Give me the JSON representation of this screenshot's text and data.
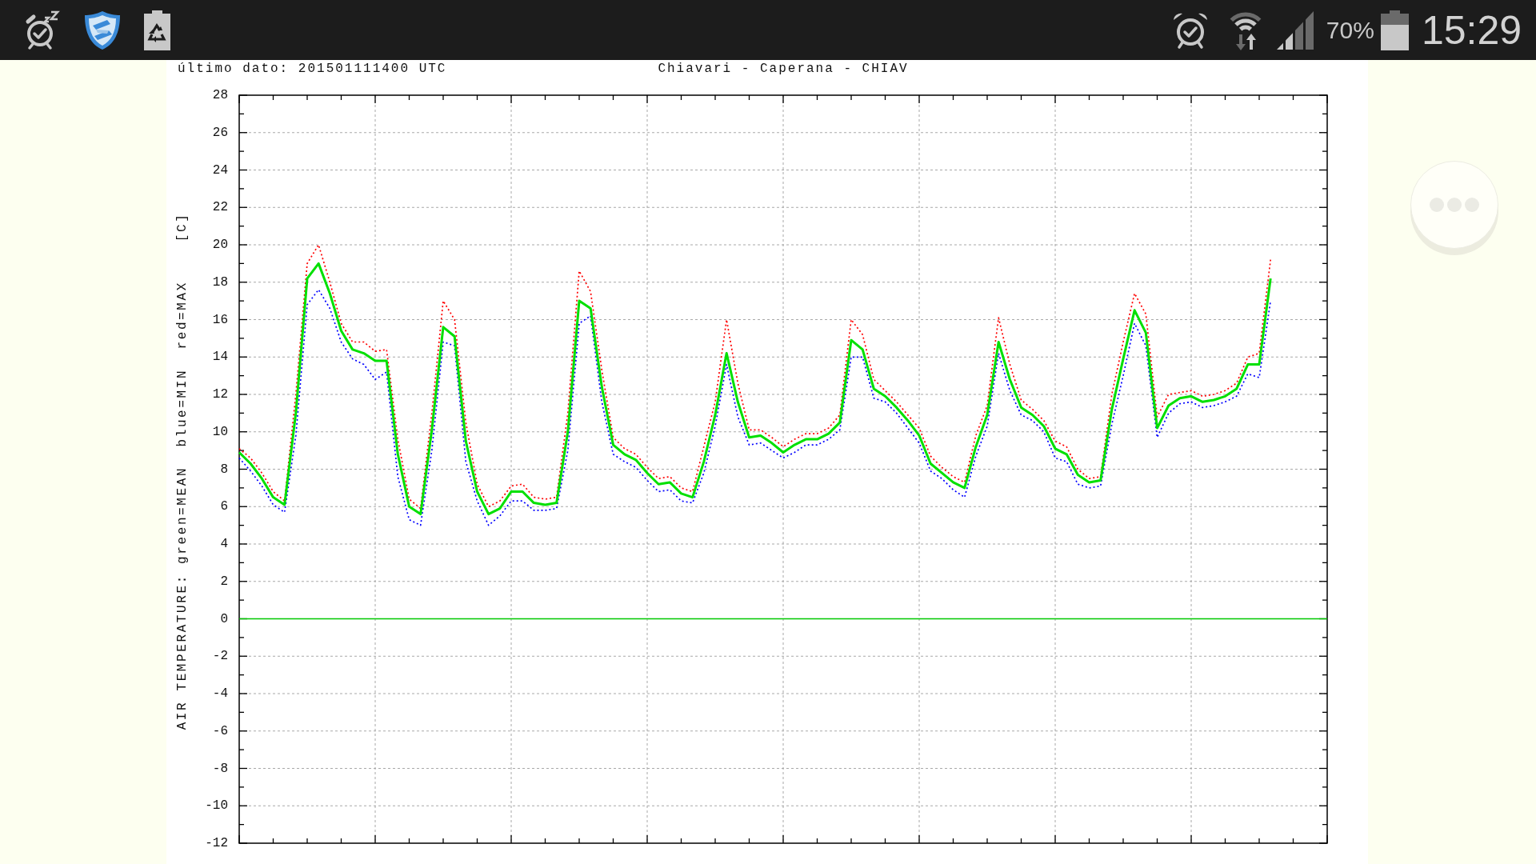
{
  "status_bar": {
    "battery": "70%",
    "time": "15:29"
  },
  "plot": {
    "last_data": "último dato: 201501111400 UTC",
    "chart_data": {
      "type": "line",
      "title": "Chiavari - Caperana - CHIAV",
      "ylabel": "AIR TEMPERATURE: green=MEAN  blue=MIN  red=MAX    [C]",
      "ylim": [
        -12,
        28
      ],
      "yticks": [
        -12,
        -10,
        -8,
        -6,
        -4,
        -2,
        0,
        2,
        4,
        6,
        8,
        10,
        12,
        14,
        16,
        18,
        20,
        22,
        24,
        26,
        28
      ],
      "grid": true,
      "series": [
        {
          "color": "#00e000",
          "line_style": "solid",
          "values": [
            8.9,
            8.3,
            7.5,
            6.5,
            6.1,
            11.0,
            18.2,
            19.0,
            17.4,
            15.4,
            14.4,
            14.2,
            13.8,
            13.8,
            8.8,
            6.0,
            5.6,
            10.1,
            15.6,
            15.1,
            9.5,
            6.8,
            5.6,
            5.9,
            6.8,
            6.8,
            6.2,
            6.1,
            6.2,
            10.0,
            17.0,
            16.6,
            12.4,
            9.3,
            8.8,
            8.5,
            7.8,
            7.2,
            7.3,
            6.7,
            6.5,
            8.4,
            10.9,
            14.2,
            11.6,
            9.7,
            9.8,
            9.4,
            8.9,
            9.3,
            9.6,
            9.6,
            9.9,
            10.5,
            14.9,
            14.4,
            12.3,
            11.9,
            11.3,
            10.6,
            9.8,
            8.3,
            7.8,
            7.3,
            7.0,
            9.2,
            10.9,
            14.8,
            12.8,
            11.3,
            10.9,
            10.3,
            9.1,
            8.8,
            7.7,
            7.3,
            7.4,
            11.2,
            13.9,
            16.5,
            15.3,
            10.2,
            11.4,
            11.8,
            11.9,
            11.6,
            11.7,
            11.9,
            12.3,
            13.6,
            13.6,
            18.2,
            null,
            null,
            null,
            null,
            null
          ]
        },
        {
          "color": "#0000ff",
          "line_style": "dotted",
          "values": [
            8.6,
            7.9,
            7.1,
            6.1,
            5.7,
            9.8,
            16.8,
            17.6,
            16.6,
            14.8,
            13.9,
            13.6,
            12.8,
            13.2,
            7.6,
            5.3,
            5.0,
            9.0,
            14.8,
            14.6,
            8.4,
            6.3,
            5.0,
            5.5,
            6.3,
            6.3,
            5.8,
            5.8,
            5.9,
            9.0,
            15.8,
            16.2,
            11.6,
            8.8,
            8.4,
            8.1,
            7.4,
            6.8,
            6.9,
            6.3,
            6.2,
            7.8,
            10.3,
            13.6,
            10.8,
            9.3,
            9.4,
            9.0,
            8.6,
            8.9,
            9.3,
            9.3,
            9.6,
            10.1,
            14.0,
            14.0,
            11.8,
            11.6,
            11.0,
            10.2,
            9.4,
            7.9,
            7.5,
            6.9,
            6.5,
            8.7,
            10.3,
            14.2,
            12.2,
            10.9,
            10.6,
            10.0,
            8.6,
            8.4,
            7.2,
            7.0,
            7.1,
            10.4,
            13.0,
            15.8,
            14.6,
            9.7,
            11.0,
            11.5,
            11.6,
            11.3,
            11.4,
            11.6,
            11.9,
            13.1,
            12.9,
            17.0,
            null,
            null,
            null,
            null,
            null
          ]
        },
        {
          "color": "#ff0000",
          "line_style": "dotted",
          "values": [
            9.1,
            8.6,
            7.8,
            6.8,
            6.3,
            12.0,
            19.0,
            20.0,
            18.0,
            15.8,
            14.8,
            14.8,
            14.3,
            14.4,
            9.6,
            6.4,
            5.9,
            11.0,
            17.0,
            16.0,
            10.5,
            7.2,
            6.0,
            6.3,
            7.1,
            7.2,
            6.5,
            6.4,
            6.5,
            11.0,
            18.6,
            17.5,
            13.3,
            9.7,
            9.1,
            8.8,
            8.1,
            7.5,
            7.6,
            7.0,
            6.8,
            9.2,
            11.6,
            16.0,
            12.6,
            10.1,
            10.1,
            9.7,
            9.2,
            9.6,
            9.9,
            9.9,
            10.2,
            10.9,
            16.0,
            15.2,
            12.8,
            12.2,
            11.6,
            10.9,
            10.2,
            8.7,
            8.1,
            7.6,
            7.3,
            9.8,
            11.4,
            16.1,
            13.6,
            11.7,
            11.2,
            10.6,
            9.5,
            9.2,
            8.0,
            7.5,
            7.6,
            12.0,
            14.8,
            17.4,
            16.3,
            10.8,
            12.0,
            12.1,
            12.2,
            11.9,
            12.0,
            12.2,
            12.6,
            14.0,
            14.2,
            19.2,
            null,
            null,
            null,
            null,
            null
          ]
        }
      ],
      "ref_lines": [
        {
          "axis": "y",
          "value": 0,
          "color": "#00c800"
        }
      ]
    }
  }
}
